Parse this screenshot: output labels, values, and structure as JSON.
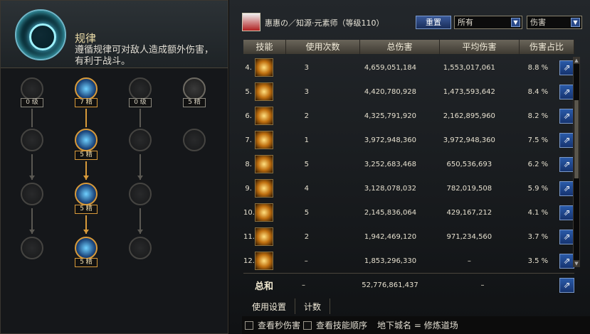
{
  "left": {
    "title": "规律",
    "description": "遵循规律可对敌人造成额外伤害，有利于战斗。",
    "skills": [
      {
        "level": "0 级"
      },
      {
        "level": "7 精"
      },
      {
        "level": "0 级"
      },
      {
        "level": "5 精"
      },
      {
        "level": "5 精"
      },
      {
        "level": "5 精"
      },
      {
        "level": "5 精"
      }
    ]
  },
  "right": {
    "player_name": "惠惠の／知源·元素师（等级110）",
    "reset_label": "重置",
    "filter_select": "所有",
    "metric_select": "伤害",
    "columns": [
      "技能",
      "使用次数",
      "总伤害",
      "平均伤害",
      "伤害占比"
    ],
    "rows": [
      {
        "num": "4.",
        "uses": "3",
        "total": "4,659,051,184",
        "avg": "1,553,017,061",
        "pct": "8.8 %"
      },
      {
        "num": "5.",
        "uses": "3",
        "total": "4,420,780,928",
        "avg": "1,473,593,642",
        "pct": "8.4 %"
      },
      {
        "num": "6.",
        "uses": "2",
        "total": "4,325,791,920",
        "avg": "2,162,895,960",
        "pct": "8.2 %"
      },
      {
        "num": "7.",
        "uses": "1",
        "total": "3,972,948,360",
        "avg": "3,972,948,360",
        "pct": "7.5 %"
      },
      {
        "num": "8.",
        "uses": "5",
        "total": "3,252,683,468",
        "avg": "650,536,693",
        "pct": "6.2 %"
      },
      {
        "num": "9.",
        "uses": "4",
        "total": "3,128,078,032",
        "avg": "782,019,508",
        "pct": "5.9 %"
      },
      {
        "num": "10.",
        "uses": "5",
        "total": "2,145,836,064",
        "avg": "429,167,212",
        "pct": "4.1 %"
      },
      {
        "num": "11.",
        "uses": "2",
        "total": "1,942,469,120",
        "avg": "971,234,560",
        "pct": "3.7 %"
      },
      {
        "num": "12.",
        "uses": "–",
        "total": "1,853,296,330",
        "avg": "–",
        "pct": "3.5 %"
      }
    ],
    "sum": {
      "label": "总和",
      "uses": "–",
      "total": "52,776,861,437",
      "avg": "–"
    },
    "tabs": [
      "使用设置",
      "计数"
    ],
    "status": {
      "check1": "查看秒伤害",
      "check2": "查看技能顺序",
      "dungeon": "地下城名 = 修炼道场"
    }
  },
  "colors": {
    "accent_gold": "#d89a3a",
    "button_blue": "#2a5aa8"
  }
}
